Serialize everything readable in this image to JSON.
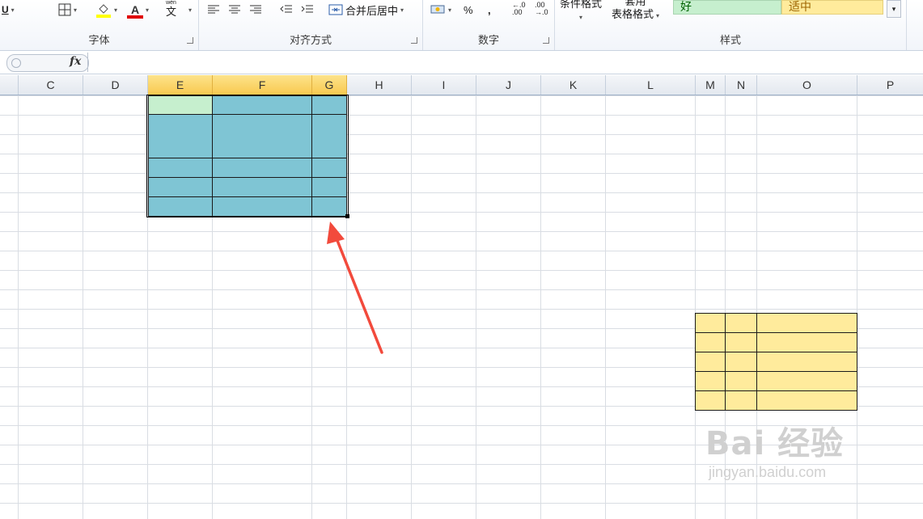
{
  "ribbon": {
    "font_group": {
      "label": "字体",
      "underline": "U",
      "font_color_letter": "A",
      "phonetic": "wén"
    },
    "align_group": {
      "label": "对齐方式",
      "merge_center": "合并后居中"
    },
    "number_group": {
      "label": "数字",
      "percent": "%",
      "comma": ",",
      "inc_decimal": ".00",
      "dec_decimal": ".00"
    },
    "styles_group": {
      "label": "样式",
      "cond_format": "条件格式",
      "table_format_line1": "套用",
      "table_format_line2": "表格格式",
      "style_good": "好",
      "style_neutral": "适中"
    }
  },
  "formula_bar": {
    "fx": "fx",
    "value": ""
  },
  "columns": [
    "C",
    "D",
    "E",
    "F",
    "G",
    "H",
    "I",
    "J",
    "K",
    "L",
    "M",
    "N",
    "O",
    "P"
  ],
  "colors": {
    "teal_fill": "#7fc5d4",
    "green_fill": "#c6efce",
    "yellow_fill": "#ffeb9c",
    "selected_header": "#f8c94f",
    "arrow": "#f24a3c"
  },
  "watermark": {
    "main": "Bai 经验",
    "sub": "jingyan.baidu.com"
  }
}
